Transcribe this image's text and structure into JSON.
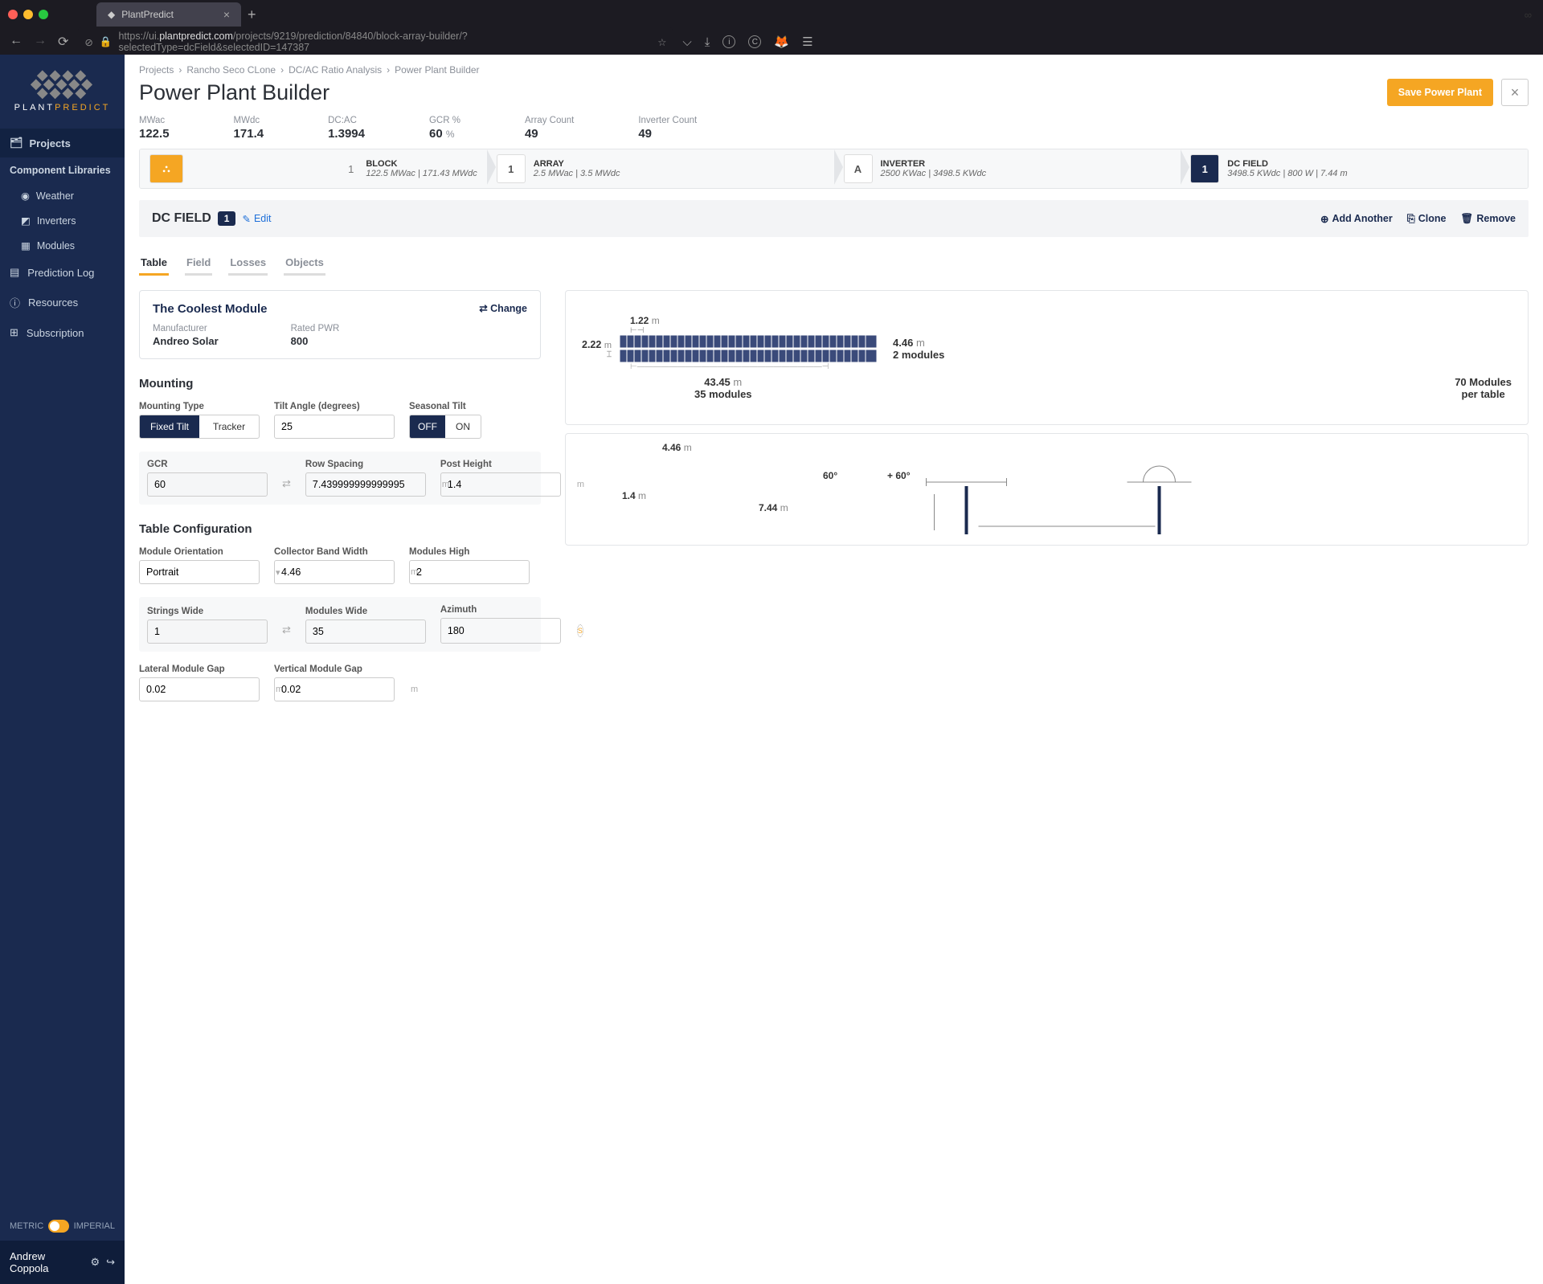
{
  "browser": {
    "tab_title": "PlantPredict",
    "url_display": "https://ui.plantpredict.com/projects/9219/prediction/84840/block-array-builder/?selectedType=dcField&selectedID=147387",
    "url_host": "plantpredict.com"
  },
  "sidebar": {
    "brand_plant": "PLANT",
    "brand_predict": "PREDICT",
    "projects": "Projects",
    "component_libraries": "Component Libraries",
    "weather": "Weather",
    "inverters": "Inverters",
    "modules": "Modules",
    "prediction_log": "Prediction Log",
    "resources": "Resources",
    "subscription": "Subscription",
    "metric": "METRIC",
    "imperial": "IMPERIAL",
    "user": "Andrew Coppola"
  },
  "breadcrumb": [
    "Projects",
    "Rancho Seco CLone",
    "DC/AC Ratio Analysis",
    "Power Plant Builder"
  ],
  "page_title": "Power Plant Builder",
  "save_btn": "Save Power Plant",
  "stats": [
    {
      "l": "MWac",
      "v": "122.5",
      "u": ""
    },
    {
      "l": "MWdc",
      "v": "171.4",
      "u": ""
    },
    {
      "l": "DC:AC",
      "v": "1.3994",
      "u": ""
    },
    {
      "l": "GCR %",
      "v": "60",
      "u": "%"
    },
    {
      "l": "Array Count",
      "v": "49",
      "u": ""
    },
    {
      "l": "Inverter Count",
      "v": "49",
      "u": ""
    }
  ],
  "steps": [
    {
      "badge": "",
      "num": "1",
      "n": "BLOCK",
      "d": "122.5 MWac | 171.43 MWdc"
    },
    {
      "badge": "1",
      "num": "",
      "n": "ARRAY",
      "d": "2.5 MWac | 3.5 MWdc"
    },
    {
      "badge": "A",
      "num": "",
      "n": "INVERTER",
      "d": "2500 KWac | 3498.5 KWdc"
    },
    {
      "badge": "1",
      "num": "",
      "n": "DC FIELD",
      "d": "3498.5 KWdc | 800 W | 7.44 m"
    }
  ],
  "section": {
    "label": "DC FIELD",
    "num": "1",
    "edit": "Edit",
    "add": "Add Another",
    "clone": "Clone",
    "remove": "Remove"
  },
  "tabs": [
    "Table",
    "Field",
    "Losses",
    "Objects"
  ],
  "module": {
    "name": "The Coolest Module",
    "change": "Change",
    "mfr_l": "Manufacturer",
    "mfr_v": "Andreo Solar",
    "pwr_l": "Rated PWR",
    "pwr_v": "800"
  },
  "mounting": {
    "title": "Mounting",
    "type_l": "Mounting Type",
    "fixed": "Fixed Tilt",
    "tracker": "Tracker",
    "tilt_l": "Tilt Angle (degrees)",
    "tilt_v": "25",
    "seasonal_l": "Seasonal Tilt",
    "off": "OFF",
    "on": "ON",
    "gcr_l": "GCR",
    "gcr_v": "60",
    "row_l": "Row Spacing",
    "row_v": "7.439999999999995",
    "post_l": "Post Height",
    "post_v": "1.4"
  },
  "table_config": {
    "title": "Table Configuration",
    "orient_l": "Module Orientation",
    "orient_v": "Portrait",
    "band_l": "Collector Band Width",
    "band_v": "4.46",
    "high_l": "Modules High",
    "high_v": "2",
    "sw_l": "Strings Wide",
    "sw_v": "1",
    "mw_l": "Modules Wide",
    "mw_v": "35",
    "az_l": "Azimuth",
    "az_v": "180",
    "lat_l": "Lateral Module Gap",
    "lat_v": "0.02",
    "vert_l": "Vertical Module Gap",
    "vert_v": "0.02"
  },
  "diagram": {
    "cell_w": "1.22",
    "cell_w_u": "m",
    "height": "2.22",
    "height_u": "m",
    "band": "4.46",
    "band_u": "m",
    "band_mod": "2 modules",
    "width": "43.45",
    "width_u": "m",
    "width_mod": "35 modules",
    "total": "70 Modules",
    "pertable": "per table",
    "post_band": "4.46",
    "post_h": "1.4",
    "pitch": "7.44",
    "tilt_neg": "60°",
    "tilt_pos": "+ 60°"
  },
  "m_unit": "m"
}
